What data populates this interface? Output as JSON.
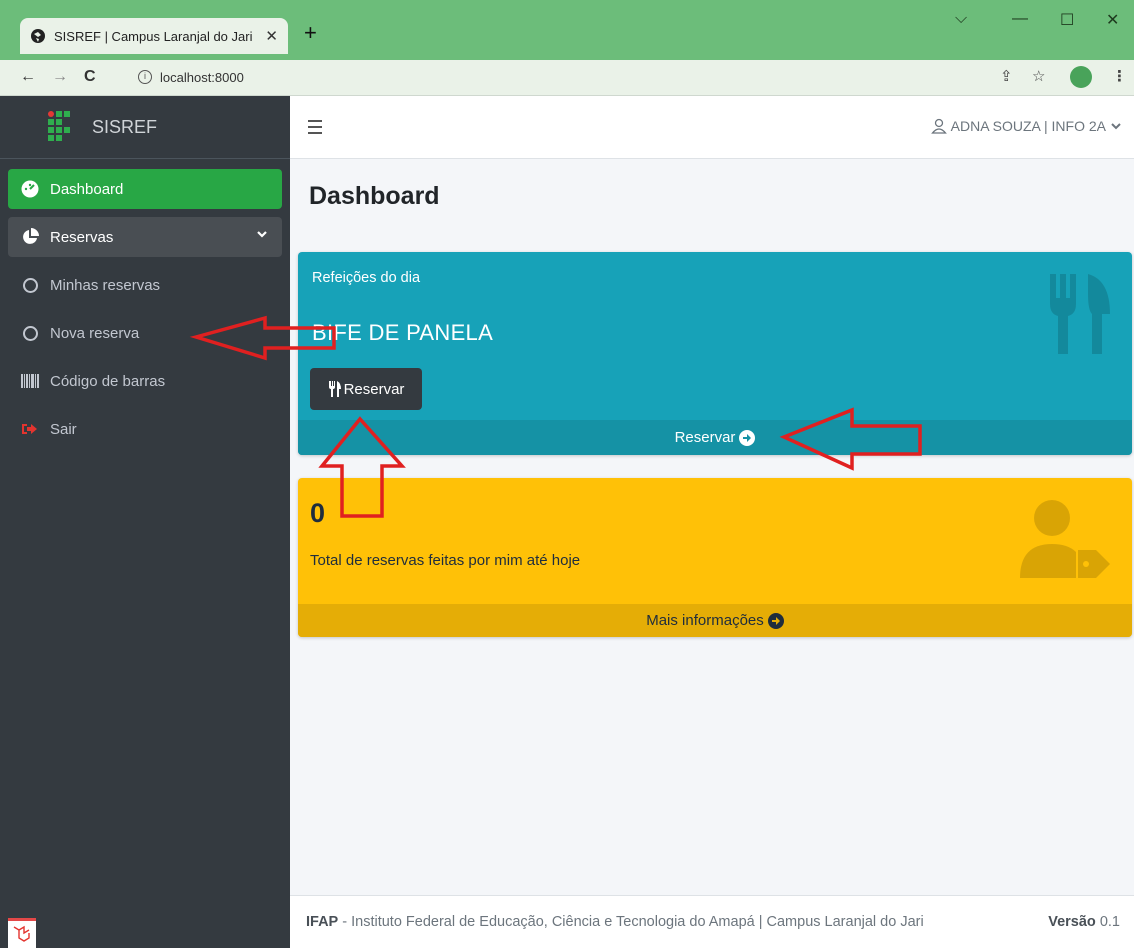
{
  "browser": {
    "tab_title": "SISREF | Campus Laranjal do Jari",
    "tab_close": "✕",
    "new_tab": "+",
    "url": "localhost:8000"
  },
  "sidebar": {
    "brand": "SISREF",
    "items": [
      {
        "label": "Dashboard",
        "icon": "tachometer-icon",
        "active": true
      },
      {
        "label": "Reservas",
        "icon": "pie-chart-icon",
        "open": true
      },
      {
        "label": "Minhas reservas",
        "icon": "circle-icon"
      },
      {
        "label": "Nova reserva",
        "icon": "circle-icon"
      },
      {
        "label": "Código de barras",
        "icon": "barcode-icon"
      },
      {
        "label": "Sair",
        "icon": "sign-out-icon"
      }
    ]
  },
  "header": {
    "user": "ADNA SOUZA | INFO 2A"
  },
  "main": {
    "title": "Dashboard",
    "meals_card": {
      "subtitle": "Refeições do dia",
      "meal": "BIFE DE PANELA",
      "button_label": "Reservar",
      "footer_link": "Reservar"
    },
    "reservations_card": {
      "count": "0",
      "description": "Total de reservas feitas por mim até hoje",
      "footer_link": "Mais informações"
    }
  },
  "footer": {
    "org": "IFAP",
    "text": " - Instituto Federal de Educação, Ciência e Tecnologia do Amapá | Campus Laranjal do Jari",
    "version_label": "Versão",
    "version_value": "0.1"
  },
  "colors": {
    "sidebar_bg": "#343a40",
    "active_green": "#28a745",
    "info": "#17a2b8",
    "warning": "#ffc107",
    "annotation_red": "#e02020"
  }
}
